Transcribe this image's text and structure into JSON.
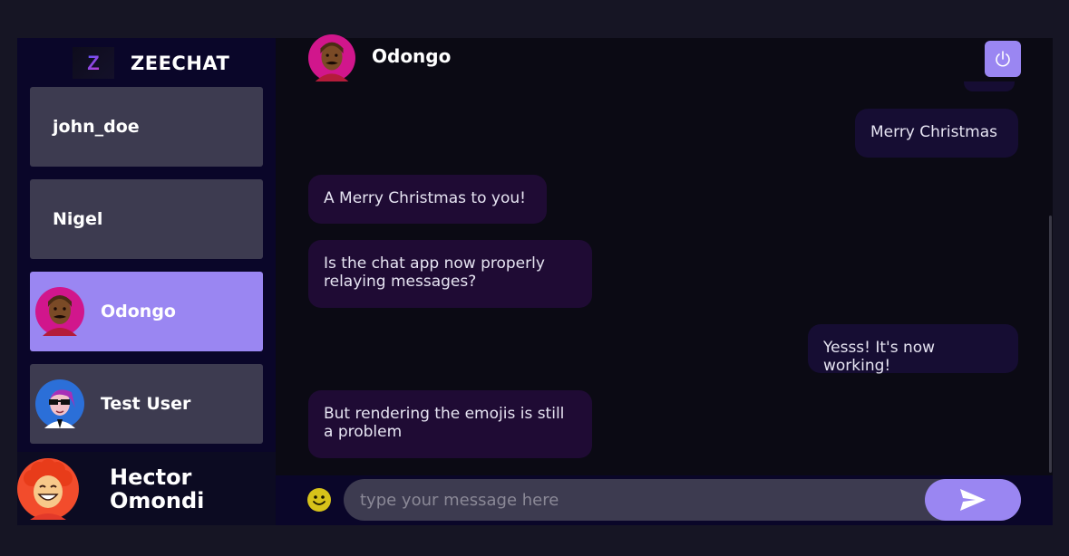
{
  "brand": {
    "logo_letter": "Z",
    "name": "ZEECHAT"
  },
  "contacts": [
    {
      "name": "john_doe",
      "avatar": null
    },
    {
      "name": "Nigel",
      "avatar": null
    },
    {
      "name": "Odongo",
      "avatar": "man-avatar-icon",
      "selected": true
    },
    {
      "name": "Test User",
      "avatar": "sunglasses-avatar-icon"
    }
  ],
  "current_user": {
    "name": "Hector Omondi",
    "avatar": "curly-hair-avatar-icon"
  },
  "chat": {
    "recipient": "Odongo",
    "messages": [
      {
        "text": "Merry Christmas",
        "direction": "outgoing"
      },
      {
        "text": "A Merry Christmas to you!",
        "direction": "incoming"
      },
      {
        "text": "Is the chat app now properly relaying messages?",
        "direction": "incoming"
      },
      {
        "text": "Yesss! It's now working!",
        "direction": "outgoing"
      },
      {
        "text": "But rendering the emojis is still a problem",
        "direction": "incoming"
      }
    ]
  },
  "composer": {
    "placeholder": "type your message here",
    "emoji_icon": "smiley-icon",
    "send_icon": "send-icon"
  },
  "colors": {
    "accent": "#9a86f2",
    "sidebar_bg": "#0a0629",
    "contact_bg": "#3d3b50",
    "incoming_bubble": "#1f0b34",
    "outgoing_bubble": "#160d33"
  }
}
